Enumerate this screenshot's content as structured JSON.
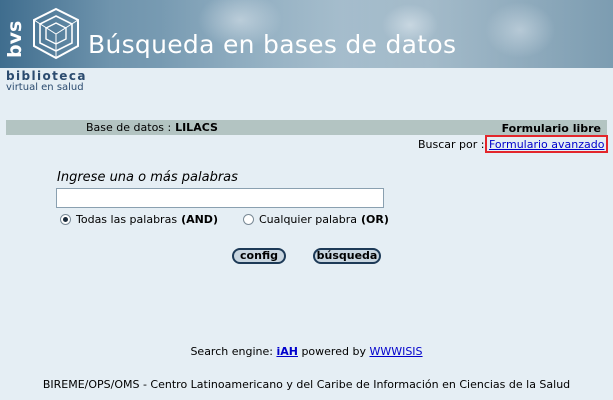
{
  "banner": {
    "logo_text": "bvs",
    "title": "Búsqueda en bases de datos",
    "brand_line1": "biblioteca",
    "brand_line2": "virtual en salud"
  },
  "db_bar": {
    "label": "Base de datos :",
    "value": "LILACS",
    "form_type": "Formulario libre"
  },
  "search_by": {
    "label": "Buscar por :",
    "advanced_link": "Formulario avanzado"
  },
  "form": {
    "prompt": "Ingrese una o más palabras",
    "input_value": "",
    "radio_all_label": "Todas las palabras",
    "radio_all_op": "(AND)",
    "radio_any_label": "Cualquier palabra",
    "radio_any_op": "(OR)",
    "selected": "all"
  },
  "buttons": {
    "config": "config",
    "search": "búsqueda"
  },
  "engine": {
    "prefix": "Search engine:",
    "iah": "iAH",
    "middle": "powered by",
    "wwwisis": "WWWISIS"
  },
  "footer": {
    "text": "BIREME/OPS/OMS - Centro Latinoamericano y del Caribe de Información en Ciencias de la Salud"
  },
  "colors": {
    "background": "#e5eef4",
    "bar": "#b3c4c2",
    "link": "#0000cc",
    "highlight": "#e3262b"
  }
}
